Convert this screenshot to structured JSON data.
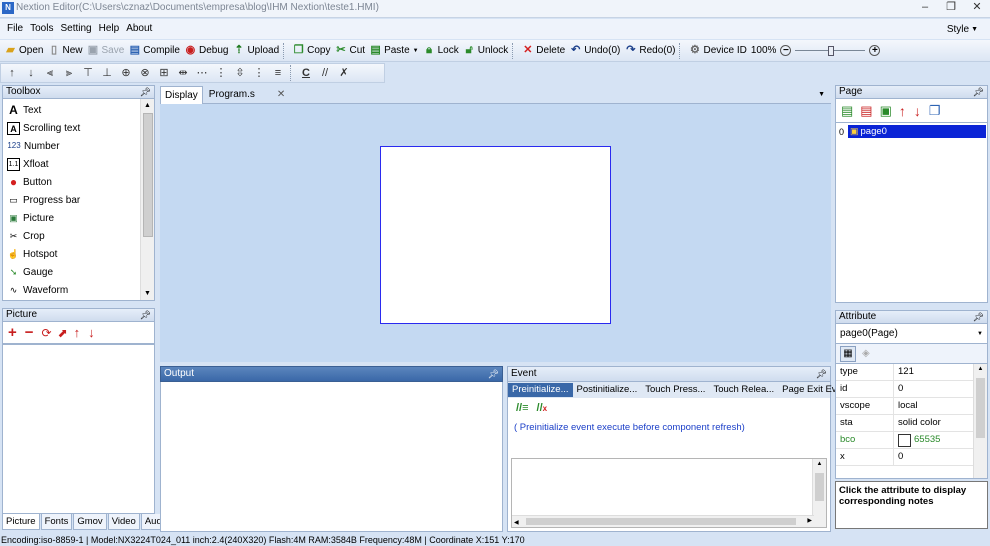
{
  "window": {
    "title": "Nextion Editor(C:\\Users\\cznaz\\Documents\\empresa\\blog\\IHM Nextion\\teste1.HMI)",
    "app_icon": "N",
    "controls": [
      "–",
      "❐",
      "✕"
    ]
  },
  "menu": {
    "items": [
      "File",
      "Tools",
      "Setting",
      "Help",
      "About"
    ],
    "style_label": "Style"
  },
  "toolbar": {
    "open": "Open",
    "new": "New",
    "save": "Save",
    "compile": "Compile",
    "debug": "Debug",
    "upload": "Upload",
    "copy": "Copy",
    "cut": "Cut",
    "paste": "Paste",
    "lock": "Lock",
    "unlock": "Unlock",
    "delete": "Delete",
    "undo": "Undo(0)",
    "redo": "Redo(0)",
    "device_id": "Device  ID",
    "zoom": "100%"
  },
  "toolbox": {
    "title": "Toolbox",
    "items": [
      {
        "label": "Text",
        "icon": "A"
      },
      {
        "label": "Scrolling text",
        "icon": "A"
      },
      {
        "label": "Number",
        "icon": "123"
      },
      {
        "label": "Xfloat",
        "icon": "1.1"
      },
      {
        "label": "Button",
        "icon": "●"
      },
      {
        "label": "Progress bar",
        "icon": "▭"
      },
      {
        "label": "Picture",
        "icon": "▣"
      },
      {
        "label": "Crop",
        "icon": "✂"
      },
      {
        "label": "Hotspot",
        "icon": "☝"
      },
      {
        "label": "Gauge",
        "icon": "➘"
      },
      {
        "label": "Waveform",
        "icon": "∿"
      }
    ]
  },
  "picture_panel": {
    "title": "Picture",
    "tabs": [
      "Picture",
      "Fonts",
      "Gmov",
      "Video",
      "Audio"
    ]
  },
  "display_tabs": [
    "Display",
    "Program.s"
  ],
  "output": {
    "title": "Output"
  },
  "event": {
    "title": "Event",
    "tabs": [
      "Preinitialize...",
      "Postinitialize...",
      "Touch Press...",
      "Touch Relea...",
      "Page Exit Ev..."
    ],
    "note": "( Preinitialize event execute before component refresh)"
  },
  "page_panel": {
    "title": "Page",
    "pages": [
      {
        "index": "0",
        "name": "page0"
      }
    ]
  },
  "attribute_panel": {
    "title": "Attribute",
    "selected": "page0(Page)",
    "rows": [
      {
        "key": "type",
        "value": "121"
      },
      {
        "key": "id",
        "value": "0"
      },
      {
        "key": "vscope",
        "value": "local"
      },
      {
        "key": "sta",
        "value": "solid color"
      },
      {
        "key": "bco",
        "value": "65535"
      },
      {
        "key": "x",
        "value": "0"
      }
    ],
    "hint": "Click the attribute to display corresponding notes"
  },
  "colors": {
    "bco_swatch": "#ffffff",
    "accent": "#3a68a8",
    "selection": "#0a24d6"
  },
  "status": "Encoding:iso-8859-1 | Model:NX3224T024_011  inch:2.4(240X320) Flash:4M RAM:3584B Frequency:48M |    Coordinate X:151  Y:170"
}
